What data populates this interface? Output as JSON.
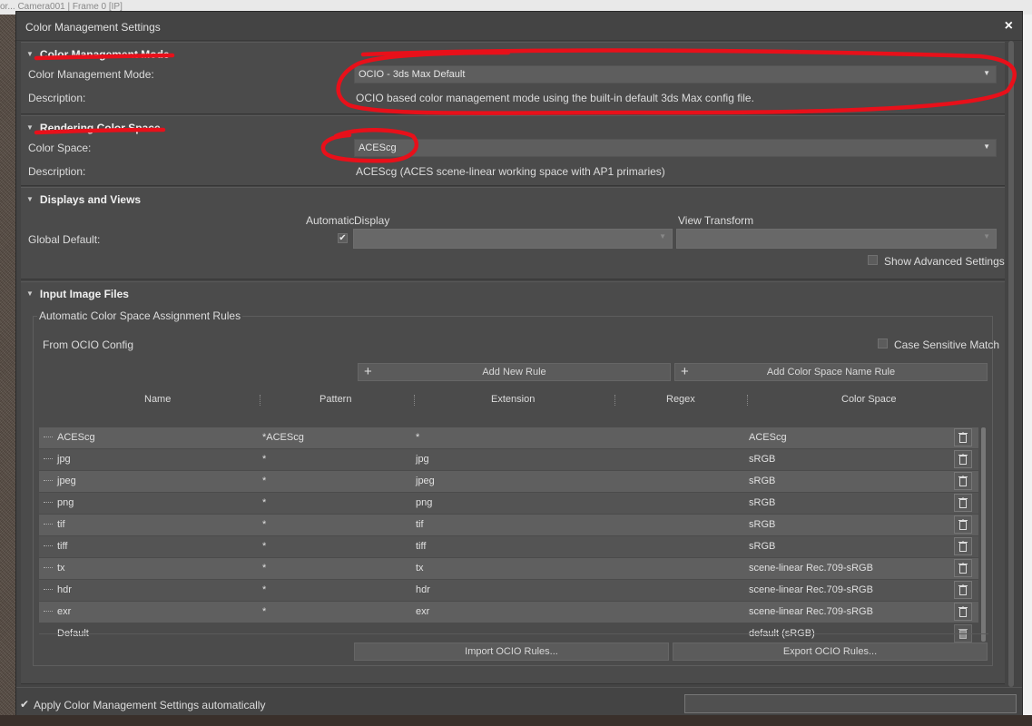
{
  "background": {
    "top_text": "or... Camera001 | Frame 0 [IP]"
  },
  "dialog": {
    "title": "Color Management Settings",
    "close_glyph": "×"
  },
  "cm_mode": {
    "header": "Color Management Mode",
    "mode_label": "Color Management Mode:",
    "mode_value": "OCIO - 3ds Max Default",
    "desc_label": "Description:",
    "desc_value": "OCIO based color management mode using the built-in default 3ds Max config file."
  },
  "rendering": {
    "header": "Rendering Color Space",
    "cs_label": "Color Space:",
    "cs_value": "ACEScg",
    "desc_label": "Description:",
    "desc_value": "ACEScg (ACES scene-linear working space with AP1 primaries)"
  },
  "displays": {
    "header": "Displays and Views",
    "automatic": "Automatic",
    "display": "Display",
    "view_transform": "View Transform",
    "global_default": "Global Default:",
    "automatic_checked": true,
    "show_advanced": "Show Advanced Settings"
  },
  "input": {
    "header": "Input Image Files",
    "group_title": "Automatic Color Space Assignment Rules",
    "from_ocio": "From OCIO Config",
    "case_sensitive": "Case Sensitive Match",
    "add_rule": "Add New Rule",
    "add_cs_rule": "Add Color Space Name Rule",
    "columns": [
      "Name",
      "Pattern",
      "Extension",
      "Regex",
      "Color Space"
    ],
    "rows": [
      {
        "name": "ACEScg",
        "pattern": "*ACEScg",
        "extension": "*",
        "regex": "",
        "cs": "ACEScg"
      },
      {
        "name": "jpg",
        "pattern": "*",
        "extension": "jpg",
        "regex": "",
        "cs": "sRGB"
      },
      {
        "name": "jpeg",
        "pattern": "*",
        "extension": "jpeg",
        "regex": "",
        "cs": "sRGB"
      },
      {
        "name": "png",
        "pattern": "*",
        "extension": "png",
        "regex": "",
        "cs": "sRGB"
      },
      {
        "name": "tif",
        "pattern": "*",
        "extension": "tif",
        "regex": "",
        "cs": "sRGB"
      },
      {
        "name": "tiff",
        "pattern": "*",
        "extension": "tiff",
        "regex": "",
        "cs": "sRGB"
      },
      {
        "name": "tx",
        "pattern": "*",
        "extension": "tx",
        "regex": "",
        "cs": "scene-linear Rec.709-sRGB"
      },
      {
        "name": "hdr",
        "pattern": "*",
        "extension": "hdr",
        "regex": "",
        "cs": "scene-linear Rec.709-sRGB"
      },
      {
        "name": "exr",
        "pattern": "*",
        "extension": "exr",
        "regex": "",
        "cs": "scene-linear Rec.709-sRGB"
      }
    ],
    "default_row": {
      "name": "Default",
      "cs": "default (sRGB)"
    },
    "import_btn": "Import OCIO Rules...",
    "export_btn": "Export OCIO Rules..."
  },
  "footer": {
    "apply_auto": "Apply Color Management Settings automatically",
    "apply_checked": true
  },
  "icons": {
    "collapse": "triangle-down-icon",
    "dropdown": "chevron-down-icon",
    "add": "plus-icon",
    "delete": "trash-icon"
  },
  "colors": {
    "annotation": "#e8101a",
    "dialog_bg": "#444444",
    "panel_bg": "#4b4b4b"
  }
}
